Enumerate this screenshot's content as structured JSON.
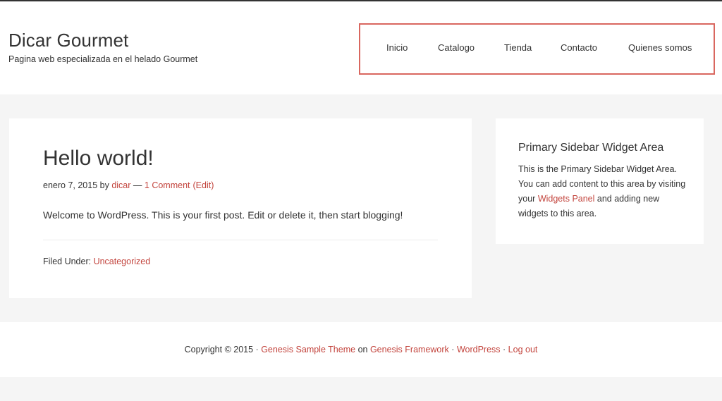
{
  "header": {
    "site_title": "Dicar Gourmet",
    "site_description": "Pagina web especializada en el helado Gourmet"
  },
  "nav": {
    "items": [
      {
        "label": "Inicio"
      },
      {
        "label": "Catalogo"
      },
      {
        "label": "Tienda"
      },
      {
        "label": "Contacto"
      },
      {
        "label": "Quienes somos"
      }
    ],
    "highlight_color": "#d9675f"
  },
  "post": {
    "title": "Hello world!",
    "date": "enero 7, 2015",
    "by": "by",
    "author": "dicar",
    "separator": "—",
    "comments": "1 Comment",
    "edit": "(Edit)",
    "content": "Welcome to WordPress. This is your first post. Edit or delete it, then start blogging!",
    "filed_under": "Filed Under:",
    "category": "Uncategorized"
  },
  "sidebar": {
    "widget_title": "Primary Sidebar Widget Area",
    "text_before": "This is the Primary Sidebar Widget Area. You can add content to this area by visiting your",
    "link": "Widgets Panel",
    "text_after": "and adding new widgets to this area."
  },
  "footer": {
    "copyright": "Copyright © 2015 ·",
    "theme_link": "Genesis Sample Theme",
    "on": "on",
    "framework_link": "Genesis Framework",
    "sep1": "·",
    "wordpress_link": "WordPress",
    "sep2": "·",
    "logout_link": "Log out"
  },
  "colors": {
    "link": "#c3453e",
    "background": "#f5f5f5",
    "card": "#ffffff"
  }
}
